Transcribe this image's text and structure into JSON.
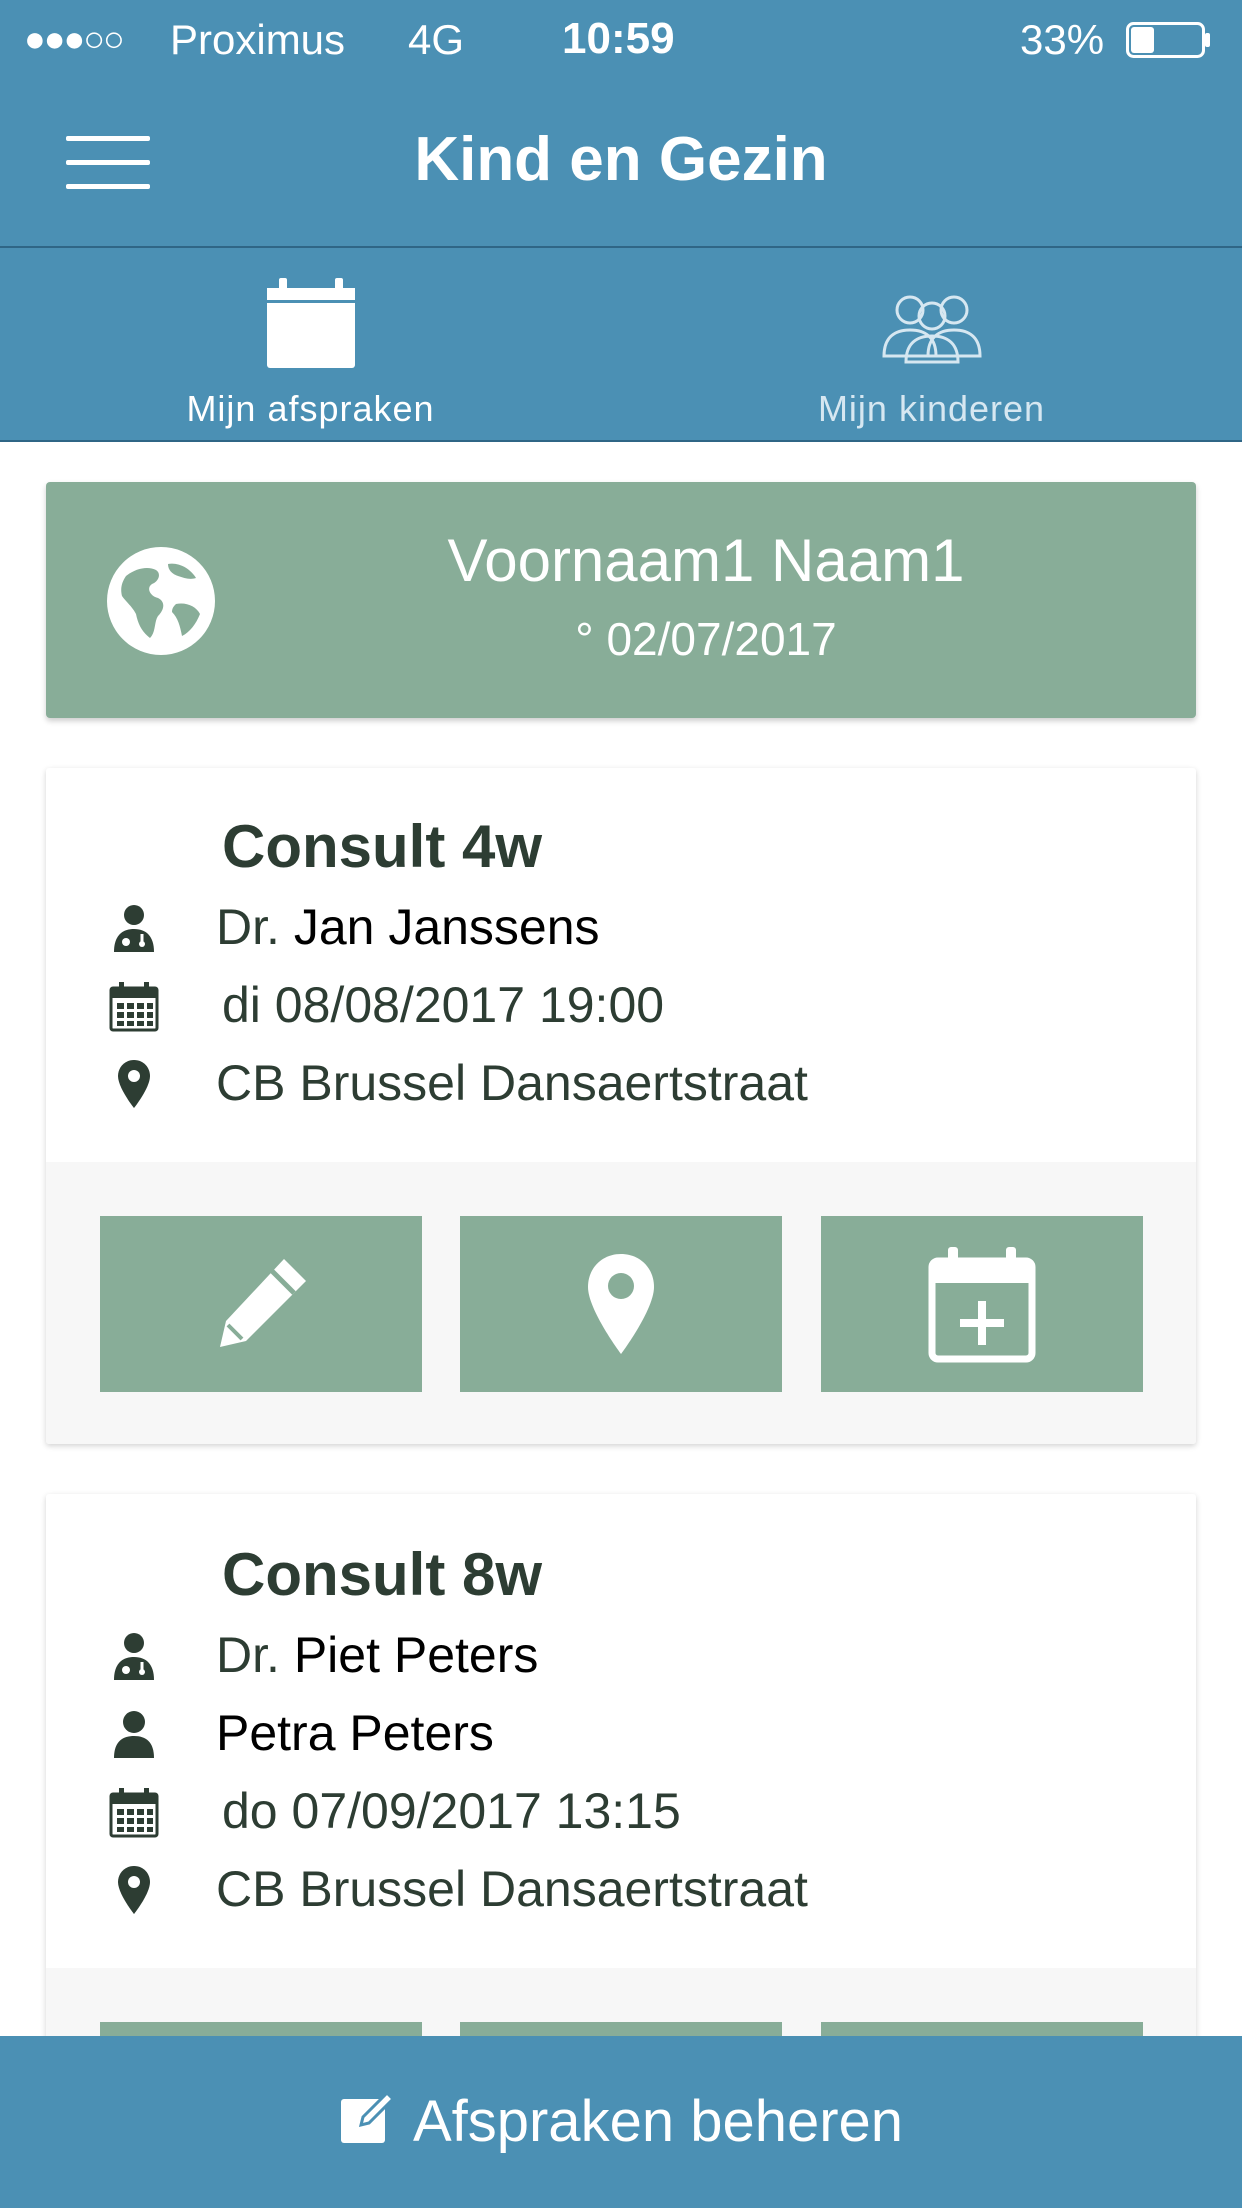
{
  "status_bar": {
    "signal": "●●●○○",
    "carrier": "Proximus",
    "network": "4G",
    "time": "10:59",
    "battery": "33%",
    "battery_level": 0.33
  },
  "header": {
    "title": "Kind en Gezin"
  },
  "tabs": [
    {
      "label": "Mijn afspraken",
      "icon": "calendar-icon",
      "active": true
    },
    {
      "label": "Mijn kinderen",
      "icon": "people-icon",
      "active": false
    }
  ],
  "profile": {
    "name": "Voornaam1 Naam1",
    "dob": "° 02/07/2017",
    "icon": "globe-icon"
  },
  "appointments": [
    {
      "title": "Consult 4w",
      "doctor_prefix": "Dr.",
      "doctor_name": "Jan Janssens",
      "datetime": "di 08/08/2017 19:00",
      "location": "CB Brussel Dansaertstraat"
    },
    {
      "title": "Consult 8w",
      "doctor_prefix": "Dr.",
      "doctor_name": "Piet Peters",
      "person": "Petra Peters",
      "datetime": "do 07/09/2017 13:15",
      "location": "CB Brussel Dansaertstraat"
    }
  ],
  "actions": [
    "pencil-icon",
    "map-pin-icon",
    "calendar-plus-icon"
  ],
  "colors": {
    "primary": "#4b90b4",
    "card_green": "#88ad98",
    "text_dark": "#2d3d33"
  },
  "footer": {
    "label": "Afspraken beheren"
  }
}
